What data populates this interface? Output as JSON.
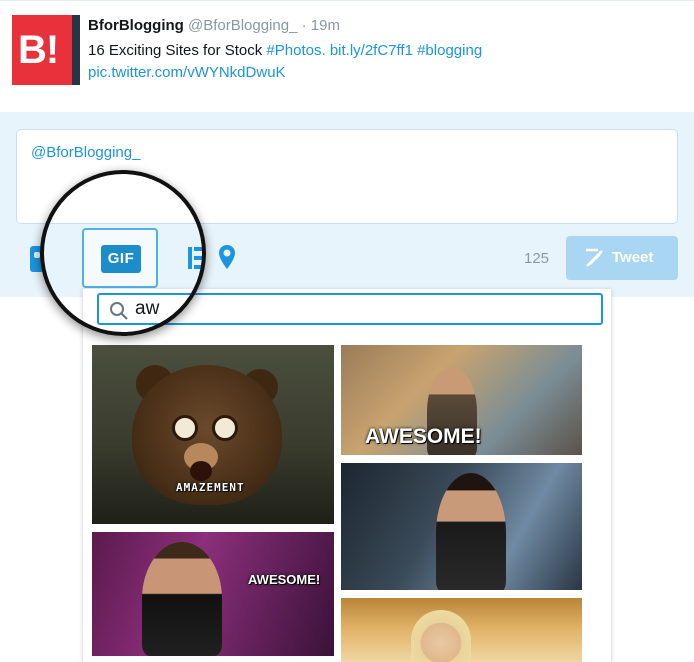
{
  "tweet": {
    "avatar_text": "B!",
    "name": "BforBlogging",
    "handle": "@BforBlogging_",
    "separator": "·",
    "time": "19m",
    "text_plain": "16 Exciting Sites for Stock ",
    "text_hashtag": "#Photos.",
    "text_link": "bit.ly/2fC7ff1",
    "text_hashtag2": "#blogging",
    "pic_link": "pic.twitter.com/vWYNkdDwuK"
  },
  "composer": {
    "text": "@BforBlogging_",
    "toolbar": {
      "icons": [
        "camera-icon",
        "gif-icon",
        "poll-icon",
        "location-icon"
      ],
      "gif_label": "GIF",
      "char_count": "125",
      "tweet_label": "Tweet"
    }
  },
  "gif_search": {
    "query": "aw",
    "results": [
      {
        "caption": "AMAZEMENT"
      },
      {
        "caption": "AWESOME!"
      },
      {
        "caption": ""
      },
      {
        "caption": "AWESOME!"
      },
      {
        "caption": ""
      }
    ]
  },
  "colors": {
    "accent": "#1b95e0",
    "composer_bg": "#e8f4fb",
    "tweet_btn_disabled": "#a9d6f3",
    "avatar_red": "#e8313a"
  }
}
